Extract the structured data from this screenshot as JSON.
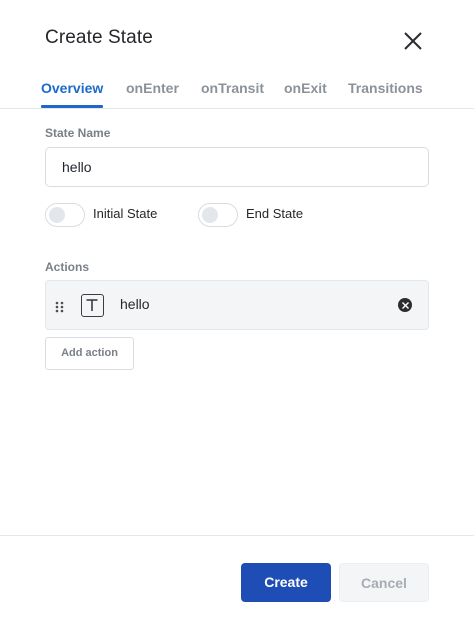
{
  "dialog": {
    "title": "Create State",
    "close_icon": "close-icon"
  },
  "tabs": [
    {
      "label": "Overview",
      "active": true
    },
    {
      "label": "onEnter",
      "active": false
    },
    {
      "label": "onTransit",
      "active": false
    },
    {
      "label": "onExit",
      "active": false
    },
    {
      "label": "Transitions",
      "active": false
    }
  ],
  "state_name": {
    "label": "State Name",
    "value": "hello"
  },
  "toggles": [
    {
      "label": "Initial State",
      "on": false
    },
    {
      "label": "End State",
      "on": false
    }
  ],
  "actions": {
    "label": "Actions",
    "items": [
      {
        "type_icon": "text-type-icon",
        "text": "hello"
      }
    ],
    "add_label": "Add action"
  },
  "footer": {
    "create_label": "Create",
    "cancel_label": "Cancel"
  },
  "colors": {
    "accent": "#1b6ac9",
    "primary_button": "#1e4eb5"
  }
}
